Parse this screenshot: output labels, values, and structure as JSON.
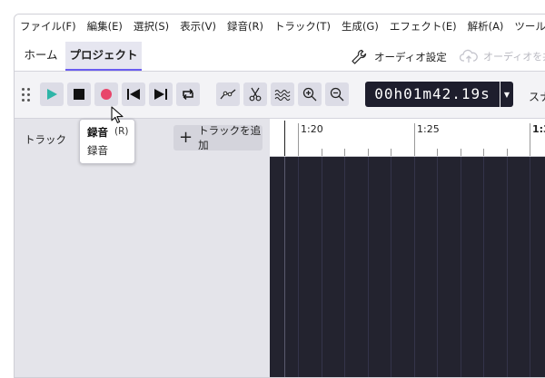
{
  "menu": [
    "ファイル(F)",
    "編集(E)",
    "選択(S)",
    "表示(V)",
    "録音(R)",
    "トラック(T)",
    "生成(G)",
    "エフェクト(E)",
    "解析(A)",
    "ツール(T"
  ],
  "tabs": {
    "home": "ホーム",
    "project": "プロジェクト"
  },
  "audio_settings": {
    "label": "オーディオ設定",
    "icon": "wrench-icon"
  },
  "audio_share": {
    "label": "オーディオを共",
    "icon": "cloud-upload-icon"
  },
  "toolbar": {
    "buttons": [
      {
        "name": "play-button",
        "icon": "play-icon"
      },
      {
        "name": "stop-button",
        "icon": "stop-icon"
      },
      {
        "name": "record-button",
        "icon": "record-icon"
      },
      {
        "name": "skip-start-button",
        "icon": "skip-start-icon"
      },
      {
        "name": "skip-end-button",
        "icon": "skip-end-icon"
      },
      {
        "name": "loop-button",
        "icon": "loop-icon"
      },
      {
        "name": "envelope-tool-button",
        "icon": "envelope-icon"
      },
      {
        "name": "split-tool-button",
        "icon": "scissors-icon"
      },
      {
        "name": "multi-tool-button",
        "icon": "wave-icon"
      },
      {
        "name": "zoom-in-button",
        "icon": "zoom-in-icon"
      },
      {
        "name": "zoom-out-button",
        "icon": "zoom-out-icon"
      }
    ],
    "time": "00h01m42.19s",
    "snap_label": "スナ"
  },
  "colors": {
    "play": "#2eb5a8",
    "record": "#e8456a",
    "accent": "#6a5cf0",
    "track_bg": "#23232f"
  },
  "left_panel": {
    "tracks_label": "トラック",
    "add_track_label": "トラックを追加"
  },
  "ruler": {
    "labels": [
      "1:20",
      "1:25",
      "1:3"
    ]
  },
  "tooltip": {
    "title": "録音",
    "shortcut": "(R)",
    "description": "録音"
  }
}
